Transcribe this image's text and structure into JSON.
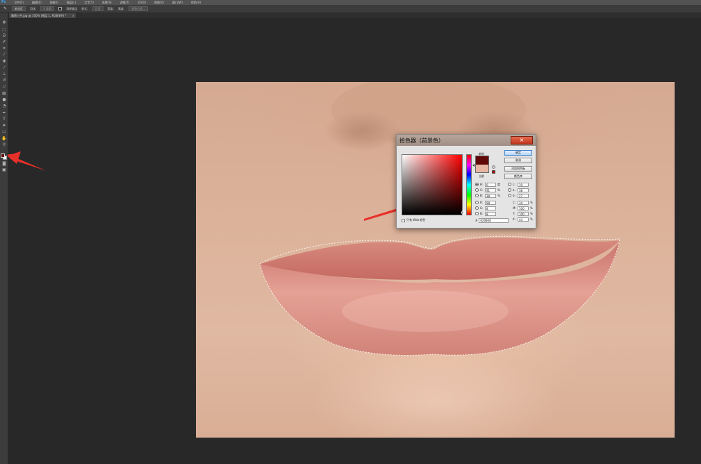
{
  "menubar": {
    "logo": "Ps",
    "items": [
      "文件(F)",
      "编辑(E)",
      "图像(I)",
      "图层(L)",
      "文字(Y)",
      "选择(S)",
      "滤镜(T)",
      "3D(D)",
      "视图(V)",
      "窗口(W)",
      "帮助(H)"
    ]
  },
  "options": {
    "new_selection": "新选区",
    "feather_label": "羽化:",
    "feather_value": "0 像素",
    "anti_alias": "消除锯齿",
    "style_label": "样式:",
    "style_value": "正常",
    "width_label": "宽度:",
    "height_label": "高度:",
    "refine_edge": "调整边缘..."
  },
  "document": {
    "tab_title": "嘴唇上色.jpg @ 100% (图层 1, RGB/8#) *",
    "close": "×"
  },
  "toolbar": {
    "foreground_color": "#620808",
    "background_color": "#ffffff"
  },
  "dialog": {
    "title": "拾色器（前景色）",
    "close": "×",
    "new_label": "新的",
    "current_label": "当前",
    "new_color": "#620808",
    "current_color": "#e7b7a3",
    "buttons": {
      "ok": "确定",
      "cancel": "取消",
      "add_swatch": "添加到色板",
      "color_libraries": "颜色库"
    },
    "hsb": [
      {
        "label": "H:",
        "value": "0",
        "unit": "度",
        "selected": true
      },
      {
        "label": "S:",
        "value": "91",
        "unit": "%",
        "selected": false
      },
      {
        "label": "B:",
        "value": "38",
        "unit": "%",
        "selected": false
      }
    ],
    "rgb": [
      {
        "label": "R:",
        "value": "98",
        "unit": "",
        "selected": false
      },
      {
        "label": "G:",
        "value": "8",
        "unit": "",
        "selected": false
      },
      {
        "label": "B:",
        "value": "8",
        "unit": "",
        "selected": false
      }
    ],
    "lab": [
      {
        "label": "L:",
        "value": "19",
        "unit": ""
      },
      {
        "label": "a:",
        "value": "38",
        "unit": ""
      },
      {
        "label": "b:",
        "value": "27",
        "unit": ""
      }
    ],
    "cmyk": [
      {
        "label": "C:",
        "value": "34",
        "unit": "%"
      },
      {
        "label": "M:",
        "value": "100",
        "unit": "%"
      },
      {
        "label": "Y:",
        "value": "100",
        "unit": "%"
      },
      {
        "label": "K:",
        "value": "44",
        "unit": "%"
      }
    ],
    "web_only_label": "只有 Web 颜色",
    "hex_label": "#",
    "hex_value": "620808"
  }
}
